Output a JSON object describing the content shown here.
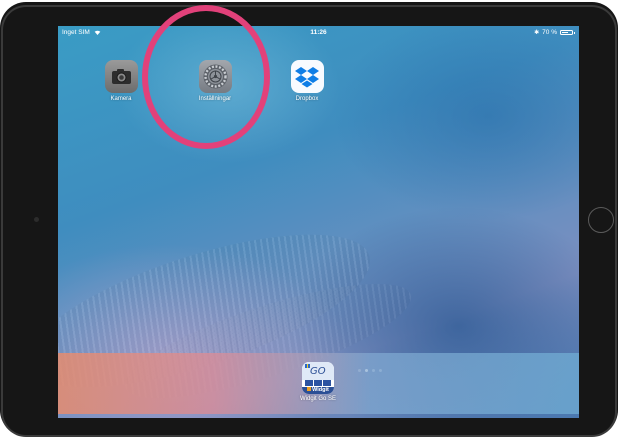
{
  "status_bar": {
    "carrier": "Inget SIM",
    "time": "11:26",
    "bluetooth": "✱",
    "battery_text": "70 %",
    "battery_level": 0.7
  },
  "apps": [
    {
      "label": "Kamera",
      "icon": "camera-icon"
    },
    {
      "label": "Inställningar",
      "icon": "settings-gear-icon"
    },
    {
      "label": "Dropbox",
      "icon": "dropbox-icon"
    }
  ],
  "dock": {
    "apps": [
      {
        "label": "Widgit Go SE",
        "icon_text": "GO",
        "brand": "Widgit"
      }
    ]
  },
  "page_indicator": {
    "total": 4,
    "active_index": 1
  },
  "highlight": {
    "target": "Inställningar",
    "color": "#e2417a"
  }
}
